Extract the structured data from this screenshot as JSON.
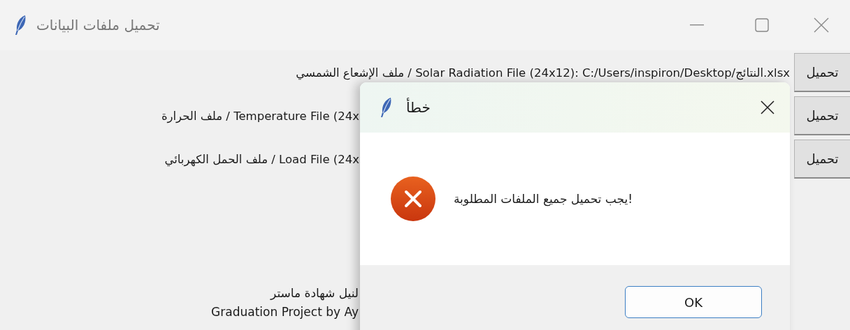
{
  "window": {
    "title": "تحميل ملفات البيانات"
  },
  "rows": [
    {
      "label": "ملف الإشعاع الشمسي / Solar Radiation File (24x12):  C:/Users/inspiron/Desktop/النتائج.xlsx",
      "button": "تحميل",
      "covered": false
    },
    {
      "label": "ملف الحرارة / Temperature File (24x",
      "button": "تحميل",
      "covered": true
    },
    {
      "label": "ملف الحمل الكهربائي / Load File (24x",
      "button": "تحميل",
      "covered": true
    }
  ],
  "footer": [
    "لنيل شهادة ماستر",
    "Graduation Project by Ay"
  ],
  "dialog": {
    "title": "خطأ",
    "message": "!يجب تحميل جميع الملفات المطلوبة",
    "button": "OK"
  }
}
